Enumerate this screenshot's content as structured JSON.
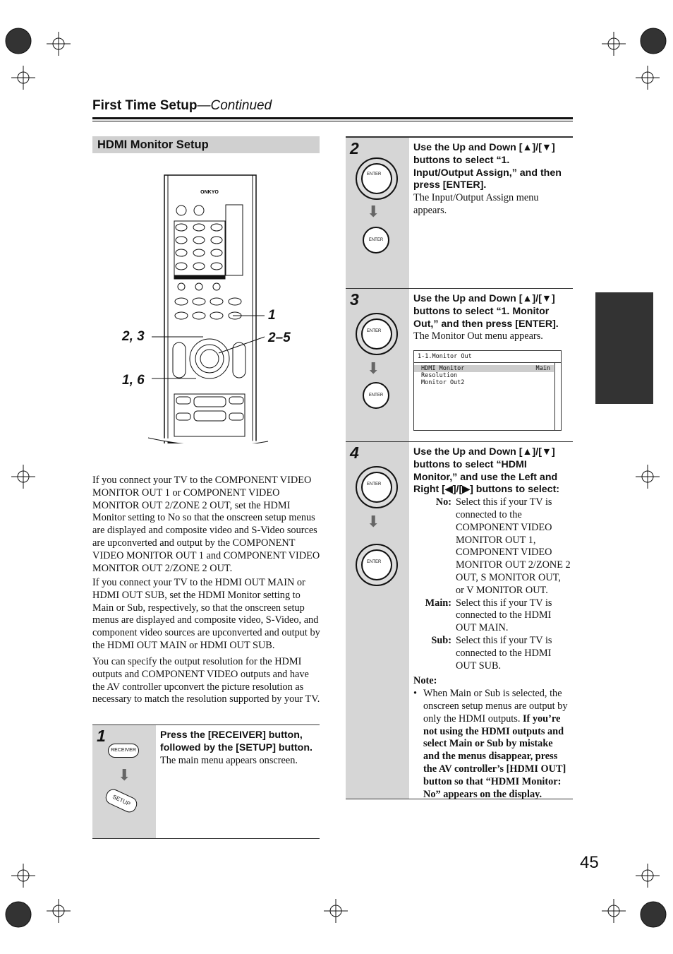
{
  "header": {
    "title": "First Time Setup",
    "continued": "—Continued"
  },
  "section": {
    "title": "HDMI Monitor Setup"
  },
  "remote": {
    "logo": "ONKYO",
    "callouts": [
      "1",
      "2, 3",
      "2–5",
      "1, 6"
    ]
  },
  "paragraphs": [
    "If you connect your TV to the COMPONENT VIDEO MONITOR OUT 1 or COMPONENT VIDEO MONITOR OUT 2/ZONE 2 OUT, set the HDMI Monitor setting to No so that the onscreen setup menus are displayed and composite video and S-Video sources are upconverted and output by the COMPONENT VIDEO MONITOR OUT 1 and COMPONENT VIDEO MONITOR OUT 2/ZONE 2 OUT.",
    "If you connect your TV to the HDMI OUT MAIN or HDMI OUT SUB, set the HDMI Monitor setting to Main or Sub, respectively, so that the onscreen setup menus are displayed and composite video, S-Video, and component video sources are upconverted and output by the HDMI OUT MAIN or HDMI OUT SUB.",
    "You can specify the output resolution for the HDMI outputs and COMPONENT VIDEO outputs and have the AV controller upconvert the picture resolution as necessary to match the resolution supported by your TV."
  ],
  "steps": [
    {
      "num": "1",
      "instruction": "Press the [RECEIVER] button, followed by the [SETUP] button.",
      "result": "The main menu appears onscreen.",
      "buttons": [
        "RECEIVER",
        "SETUP"
      ]
    },
    {
      "num": "2",
      "instruction": "Use the Up and Down [▲]/[▼] buttons to select “1. Input/Output Assign,” and then press [ENTER].",
      "result": "The Input/Output Assign menu appears.",
      "buttons": [
        "ENTER"
      ]
    },
    {
      "num": "3",
      "instruction": "Use the Up and Down [▲]/[▼] buttons to select “1. Monitor Out,” and then press [ENTER].",
      "result": "The Monitor Out menu appears.",
      "buttons": [
        "ENTER"
      ],
      "screen": {
        "title": "1-1.Monitor Out",
        "items": [
          {
            "label": "HDMI Monitor",
            "value": "Main"
          },
          {
            "label": "Resolution",
            "value": ""
          },
          {
            "label": "Monitor Out2",
            "value": ""
          }
        ]
      }
    },
    {
      "num": "4",
      "instruction": "Use the Up and Down [▲]/[▼] buttons to select “HDMI Monitor,” and use the Left and Right [◀]/[▶] buttons to select:",
      "buttons": [
        "ENTER"
      ],
      "options": [
        {
          "key": "No:",
          "desc": "Select this if your TV is connected to the COMPONENT VIDEO MONITOR OUT 1, COMPONENT VIDEO MONITOR OUT 2/ZONE 2 OUT, S MONITOR OUT, or V MONITOR OUT."
        },
        {
          "key": "Main:",
          "desc": "Select this if your TV is connected to the HDMI OUT MAIN."
        },
        {
          "key": "Sub:",
          "desc": "Select this if your TV is connected to the HDMI OUT SUB."
        }
      ],
      "note_label": "Note:",
      "note_plain": "When Main or Sub is selected, the onscreen setup menus are output by only the HDMI outputs.",
      "note_bold": "If you’re not using the HDMI outputs and select Main or Sub by mistake and the menus disappear, press the AV controller’s [HDMI OUT] button so that “HDMI Monitor: No” appears on the display."
    }
  ],
  "page_number": "45"
}
